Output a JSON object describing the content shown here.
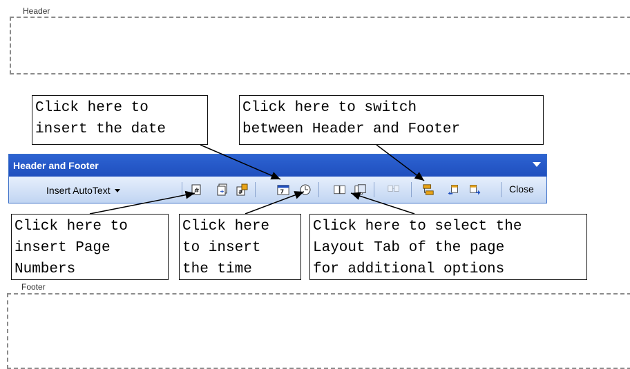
{
  "header_area": {
    "label": "Header"
  },
  "footer_area": {
    "label": "Footer"
  },
  "toolbar": {
    "title": "Header and Footer",
    "insert_autotext_label": "Insert AutoText",
    "close_label": "Close",
    "icons": [
      "insert-page-number-icon",
      "insert-number-of-pages-icon",
      "format-page-number-icon",
      "insert-date-icon",
      "insert-time-icon",
      "page-setup-icon",
      "show-hide-document-text-icon",
      "same-as-previous-icon",
      "switch-header-footer-icon",
      "show-previous-icon",
      "show-next-icon"
    ]
  },
  "callouts": {
    "date": "Click here to\ninsert the date",
    "switch": "Click here to switch\nbetween Header and Footer",
    "page_numbers": "Click here to\ninsert Page\nNumbers",
    "time": "Click here\nto insert\nthe time",
    "layout": "Click here to select the\nLayout Tab of the page\nfor additional options"
  },
  "colors": {
    "toolbar_title_bg": "#2d63d2",
    "toolbar_body_bg": "#c6daf6"
  }
}
